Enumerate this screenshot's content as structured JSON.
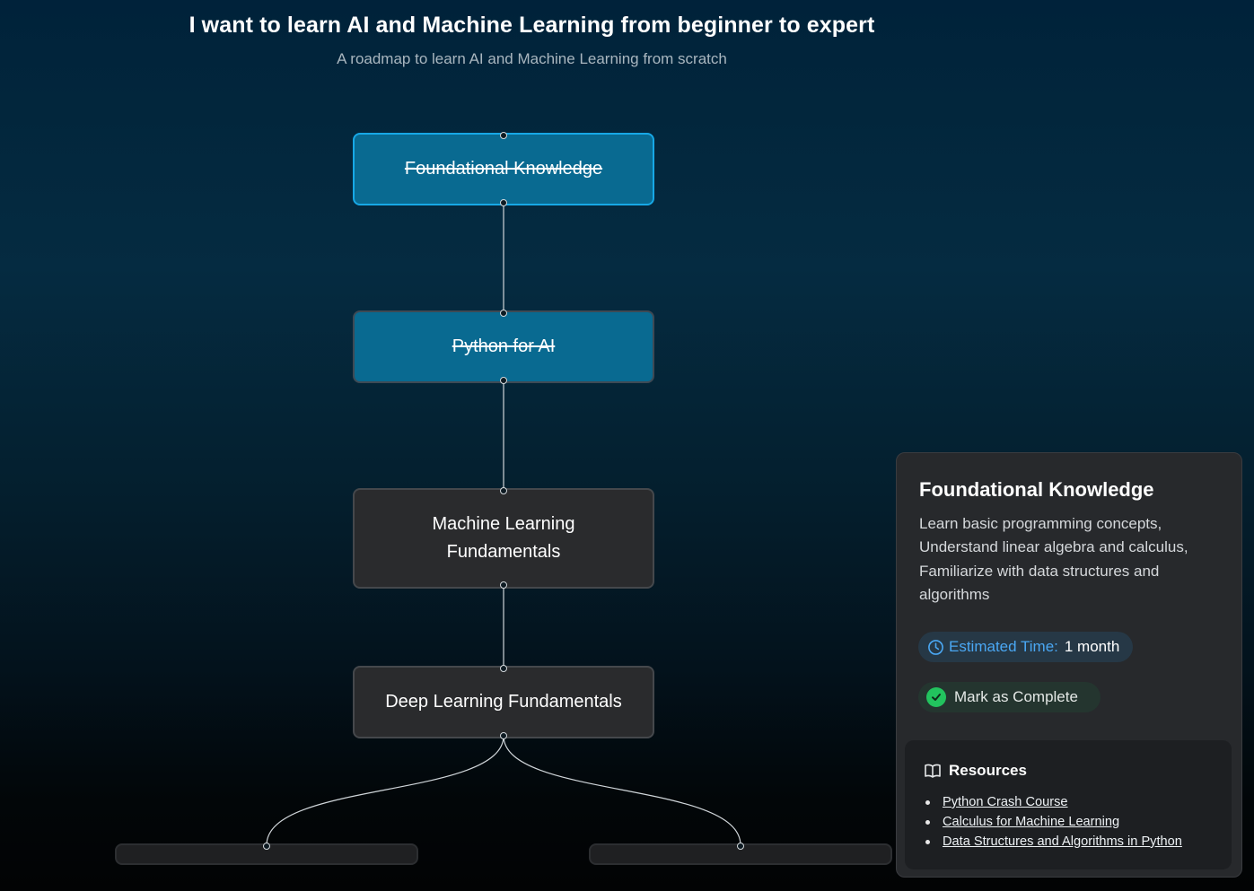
{
  "header": {
    "title": "I want to learn AI and Machine Learning from beginner to expert",
    "subtitle": "A roadmap to learn AI and Machine Learning from scratch"
  },
  "roadmap": {
    "nodes": [
      {
        "label": "Foundational Knowledge",
        "status": "completed",
        "selected": true
      },
      {
        "label": "Python for AI",
        "status": "completed",
        "selected": false
      },
      {
        "label": "Machine Learning Fundamentals",
        "status": "pending",
        "selected": false
      },
      {
        "label": "Deep Learning Fundamentals",
        "status": "pending",
        "selected": false
      }
    ]
  },
  "detail_panel": {
    "title": "Foundational Knowledge",
    "description": "Learn basic programming concepts, Understand linear algebra and calculus, Familiarize with data structures and algorithms",
    "estimated_time_label": "Estimated Time:",
    "estimated_time_value": "1 month",
    "mark_complete_label": "Mark as Complete",
    "resources_heading": "Resources",
    "resources": [
      "Python Crash Course",
      "Calculus for Machine Learning",
      "Data Structures and Algorithms in Python"
    ]
  },
  "colors": {
    "completed_node": "#096a91",
    "selected_border": "#17a8e6",
    "pending_node": "#2a2b2d",
    "accent_blue": "#4aa7f3",
    "success_green": "#22c35e"
  },
  "icons": {
    "time": "clock-icon",
    "complete": "check-circle-icon",
    "resources": "book-open-icon"
  }
}
